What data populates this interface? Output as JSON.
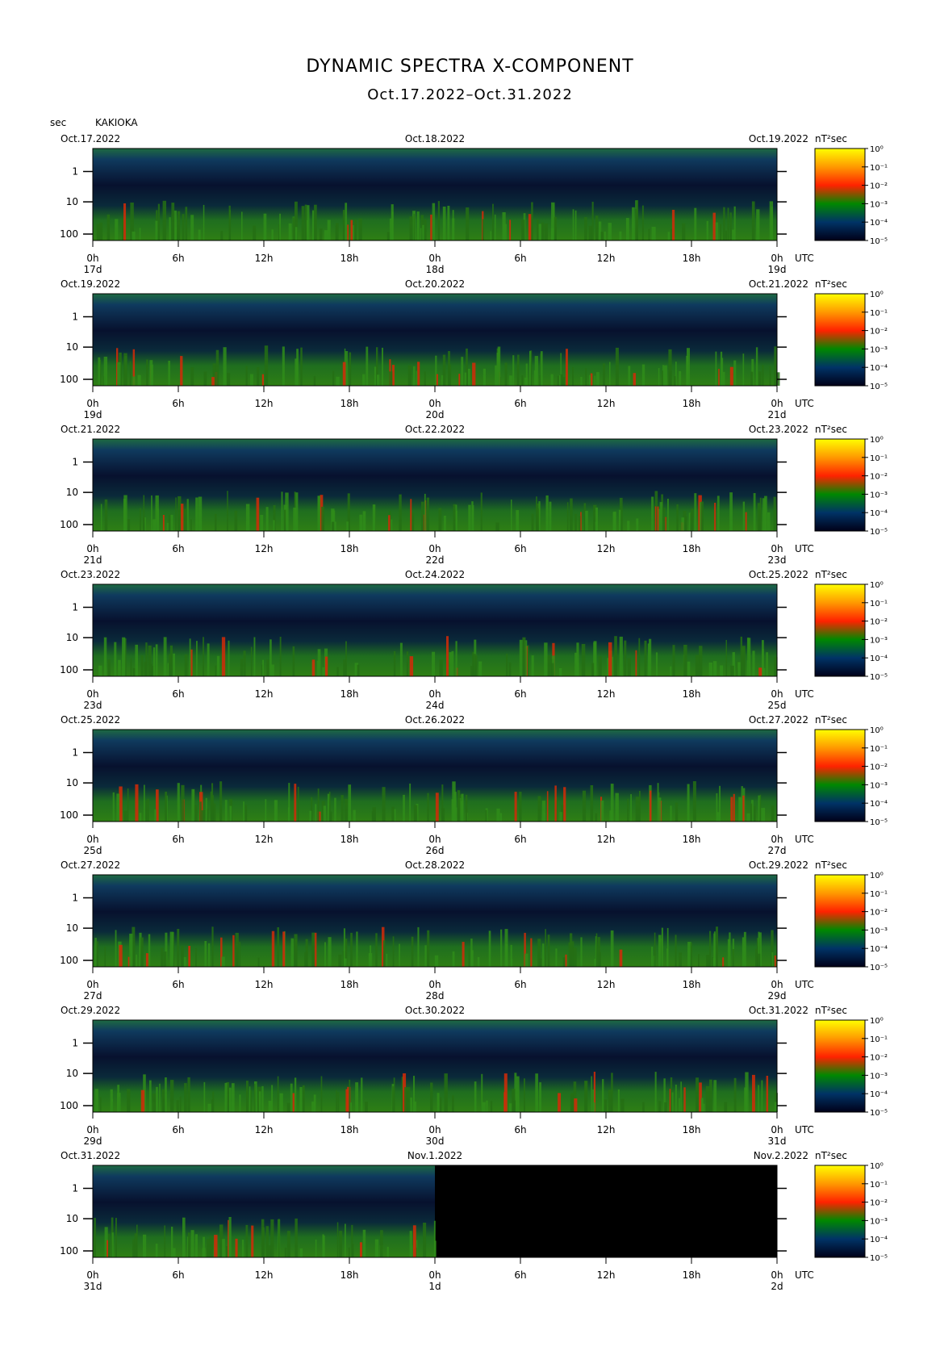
{
  "header": {
    "title": "DYNAMIC SPECTRA X-COMPONENT",
    "subtitle": "Oct.17.2022–Oct.31.2022",
    "unit_label": "sec",
    "station": "KAKIOKA"
  },
  "chart_data": {
    "type": "heatmap",
    "component": "X",
    "y_axis": {
      "label": "sec",
      "ticks": [
        "1",
        "10",
        "100"
      ],
      "scale": "log"
    },
    "x_axis": {
      "ticks": [
        "0h",
        "6h",
        "12h",
        "18h",
        "0h",
        "6h",
        "12h",
        "18h",
        "0h"
      ],
      "utc_label": "UTC"
    },
    "colorbar": {
      "unit": "nT²sec",
      "unit_html": "nT <sup>2</sup>sec",
      "ticks": [
        "10⁰",
        "10⁻¹",
        "10⁻²",
        "10⁻³",
        "10⁻⁴",
        "10⁻⁵"
      ],
      "colors": [
        "#ffff00",
        "#ff9900",
        "#ff2200",
        "#008800",
        "#003366",
        "#000018"
      ]
    },
    "panels": [
      {
        "left_date": "Oct.17.2022",
        "mid_date": "Oct.18.2022",
        "right_date": "Oct.19.2022",
        "day_labels": [
          "17d",
          "18d",
          "19d"
        ]
      },
      {
        "left_date": "Oct.19.2022",
        "mid_date": "Oct.20.2022",
        "right_date": "Oct.21.2022",
        "day_labels": [
          "19d",
          "20d",
          "21d"
        ]
      },
      {
        "left_date": "Oct.21.2022",
        "mid_date": "Oct.22.2022",
        "right_date": "Oct.23.2022",
        "day_labels": [
          "21d",
          "22d",
          "23d"
        ]
      },
      {
        "left_date": "Oct.23.2022",
        "mid_date": "Oct.24.2022",
        "right_date": "Oct.25.2022",
        "day_labels": [
          "23d",
          "24d",
          "25d"
        ]
      },
      {
        "left_date": "Oct.25.2022",
        "mid_date": "Oct.26.2022",
        "right_date": "Oct.27.2022",
        "day_labels": [
          "25d",
          "26d",
          "27d"
        ]
      },
      {
        "left_date": "Oct.27.2022",
        "mid_date": "Oct.28.2022",
        "right_date": "Oct.29.2022",
        "day_labels": [
          "27d",
          "28d",
          "29d"
        ]
      },
      {
        "left_date": "Oct.29.2022",
        "mid_date": "Oct.30.2022",
        "right_date": "Oct.31.2022",
        "day_labels": [
          "29d",
          "30d",
          "31d"
        ]
      },
      {
        "left_date": "Oct.31.2022",
        "mid_date": "Nov.1.2022",
        "right_date": "Nov.2.2022",
        "day_labels": [
          "31d",
          "1d",
          "2d"
        ],
        "data_until_hour": 24
      }
    ]
  }
}
